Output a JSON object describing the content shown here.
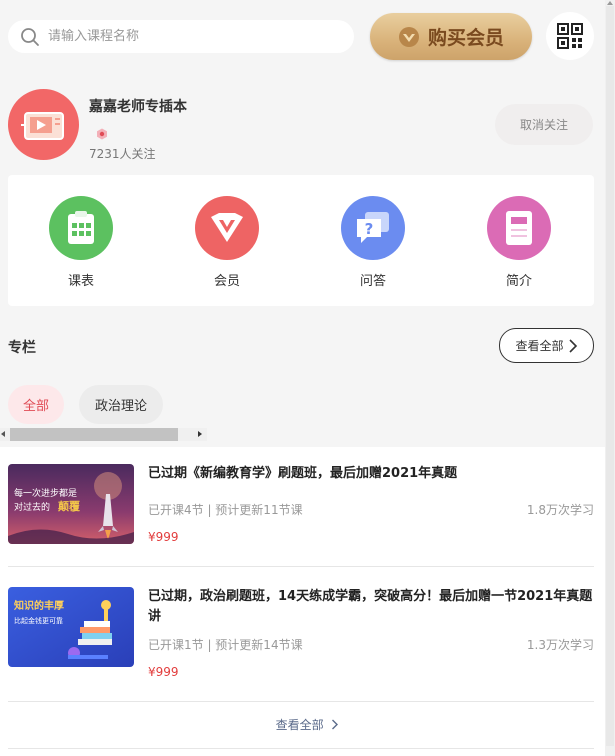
{
  "search": {
    "placeholder": "请输入课程名称"
  },
  "buy_vip": {
    "label": "购买会员"
  },
  "profile": {
    "name": "嘉嘉老师专插本",
    "followers": "7231人关注",
    "unfollow_label": "取消关注"
  },
  "menu": [
    {
      "label": "课表",
      "color": "#5cc160",
      "icon": "calendar-icon"
    },
    {
      "label": "会员",
      "color": "#ee6464",
      "icon": "vip-icon"
    },
    {
      "label": "问答",
      "color": "#6b8cf0",
      "icon": "qa-icon"
    },
    {
      "label": "简介",
      "color": "#db6bb5",
      "icon": "intro-icon"
    }
  ],
  "section": {
    "title": "专栏",
    "view_all": "查看全部",
    "tabs": [
      {
        "label": "全部",
        "active": true
      },
      {
        "label": "政治理论",
        "active": false
      }
    ]
  },
  "courses": [
    {
      "title": "已过期《新编教育学》刷题班，最后加赠2021年真题",
      "meta": "已开课4节 | 预计更新11节课",
      "study": "1.8万次学习",
      "price": "¥999",
      "thumb_text_1": "每一次进步都是",
      "thumb_text_2": "对过去的",
      "thumb_text_3": "颠覆"
    },
    {
      "title": "已过期，政治刷题班，14天练成学霸，突破高分！最后加赠一节2021年真题讲",
      "meta": "已开课1节 | 预计更新14节课",
      "study": "1.3万次学习",
      "price": "¥999",
      "thumb_text_1": "知识的丰厚",
      "thumb_text_2": "比起金钱更可靠"
    }
  ],
  "footer": {
    "more": "查看全部"
  },
  "colors": {
    "accent_red": "#e04b55",
    "gold": "#d9b27a",
    "price": "#e23c3c"
  }
}
